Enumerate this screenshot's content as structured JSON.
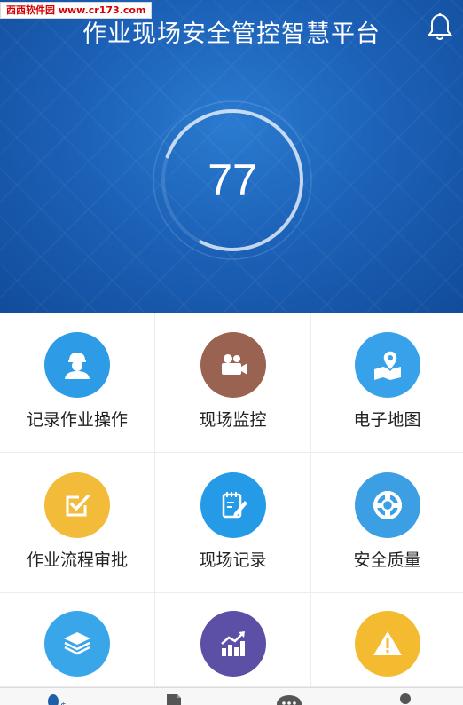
{
  "watermark": "西西软件园 www.cr173.com",
  "header": {
    "title": "作业现场安全管控智慧平台",
    "bell_icon": "bell-icon"
  },
  "score": {
    "value": "77",
    "progress": 0.77
  },
  "menu": [
    {
      "id": "record-operation",
      "label": "记录作业操作",
      "icon": "worker-icon",
      "color": "#2d9be6"
    },
    {
      "id": "site-monitor",
      "label": "现场监控",
      "icon": "video-camera-icon",
      "color": "#9a6250"
    },
    {
      "id": "e-map",
      "label": "电子地图",
      "icon": "map-pin-icon",
      "color": "#37a2ea"
    },
    {
      "id": "workflow-approval",
      "label": "作业流程审批",
      "icon": "checkbox-icon",
      "color": "#f2bb3a"
    },
    {
      "id": "site-record",
      "label": "现场记录",
      "icon": "notepad-pen-icon",
      "color": "#259be8"
    },
    {
      "id": "safety-quality",
      "label": "安全质量",
      "icon": "lifebuoy-icon",
      "color": "#3c9fe4"
    },
    {
      "id": "layers",
      "label": "",
      "icon": "layers-icon",
      "color": "#3aa6ea"
    },
    {
      "id": "statistics",
      "label": "",
      "icon": "chart-up-icon",
      "color": "#5c4fa6"
    },
    {
      "id": "warning",
      "label": "",
      "icon": "warning-icon",
      "color": "#f4bb31"
    }
  ],
  "tabs": [
    {
      "icon": "person-dollar-icon"
    },
    {
      "icon": "document-icon"
    },
    {
      "icon": "chat-icon"
    },
    {
      "icon": "user-icon"
    }
  ]
}
